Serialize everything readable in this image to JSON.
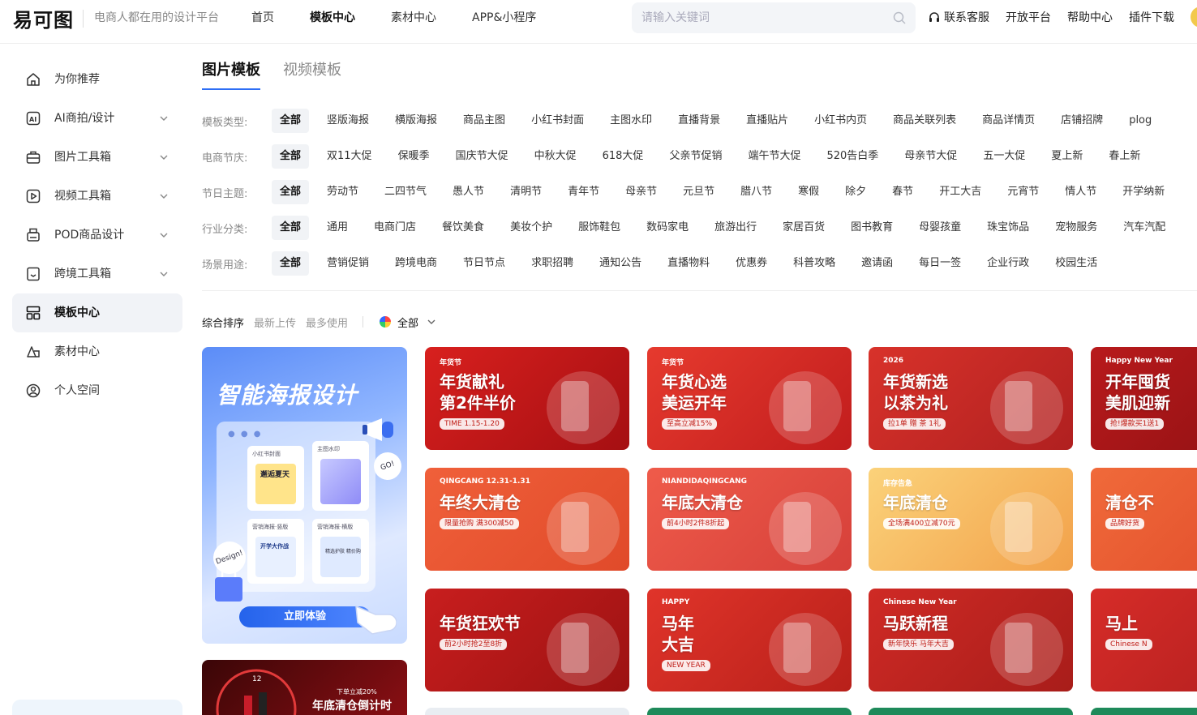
{
  "header": {
    "logo": "易可图",
    "slogan": "电商人都在用的设计平台",
    "nav": [
      "首页",
      "模板中心",
      "素材中心",
      "APP&小程序"
    ],
    "nav_active": 1,
    "search_placeholder": "请输入关键词",
    "links": [
      "联系客服",
      "开放平台",
      "帮助中心",
      "插件下载"
    ]
  },
  "sidebar": {
    "items": [
      {
        "label": "为你推荐",
        "icon": "home-icon",
        "expandable": false
      },
      {
        "label": "AI商拍/设计",
        "icon": "ai-icon",
        "expandable": true
      },
      {
        "label": "图片工具箱",
        "icon": "toolbox-icon",
        "expandable": true
      },
      {
        "label": "视频工具箱",
        "icon": "video-icon",
        "expandable": true
      },
      {
        "label": "POD商品设计",
        "icon": "print-icon",
        "expandable": true
      },
      {
        "label": "跨境工具箱",
        "icon": "bookmark-icon",
        "expandable": true
      },
      {
        "label": "模板中心",
        "icon": "grid-icon",
        "expandable": false
      },
      {
        "label": "素材中心",
        "icon": "shapes-icon",
        "expandable": false
      },
      {
        "label": "个人空间",
        "icon": "user-icon",
        "expandable": false
      }
    ],
    "active_index": 6
  },
  "tabs": [
    "图片模板",
    "视频模板"
  ],
  "filters": [
    {
      "label": "模板类型:",
      "options": [
        "全部",
        "竖版海报",
        "横版海报",
        "商品主图",
        "小红书封面",
        "主图水印",
        "直播背景",
        "直播贴片",
        "小红书内页",
        "商品关联列表",
        "商品详情页",
        "店铺招牌",
        "plog"
      ]
    },
    {
      "label": "电商节庆:",
      "options": [
        "全部",
        "双11大促",
        "保暖季",
        "国庆节大促",
        "中秋大促",
        "618大促",
        "父亲节促销",
        "端午节大促",
        "520告白季",
        "母亲节大促",
        "五一大促",
        "夏上新",
        "春上新"
      ]
    },
    {
      "label": "节日主题:",
      "options": [
        "全部",
        "劳动节",
        "二四节气",
        "愚人节",
        "清明节",
        "青年节",
        "母亲节",
        "元旦节",
        "腊八节",
        "寒假",
        "除夕",
        "春节",
        "开工大吉",
        "元宵节",
        "情人节",
        "开学纳新"
      ]
    },
    {
      "label": "行业分类:",
      "options": [
        "全部",
        "通用",
        "电商门店",
        "餐饮美食",
        "美妆个护",
        "服饰鞋包",
        "数码家电",
        "旅游出行",
        "家居百货",
        "图书教育",
        "母婴孩童",
        "珠宝饰品",
        "宠物服务",
        "汽车汽配"
      ]
    },
    {
      "label": "场景用途:",
      "options": [
        "全部",
        "营销促销",
        "跨境电商",
        "节日节点",
        "求职招聘",
        "通知公告",
        "直播物料",
        "优惠券",
        "科普攻略",
        "邀请函",
        "每日一签",
        "企业行政",
        "校园生活"
      ]
    }
  ],
  "sort": {
    "options": [
      "综合排序",
      "最新上传",
      "最多使用"
    ],
    "active": 0,
    "color_filter": "全部"
  },
  "poster": {
    "title": "智能海报设计",
    "card_labels": [
      "小红书封面",
      "主图水印",
      "营销海报·竖版",
      "营销海报·横版"
    ],
    "card_texts": [
      "邂逅夏天",
      "开学大作战",
      "精选护肤 精价购"
    ],
    "badges": [
      "GO!",
      "Design!"
    ],
    "cta": "立即体验"
  },
  "bottom_card": {
    "sub": "下单立减20%",
    "title": "年底清仓倒计时"
  },
  "cards": [
    {
      "tag": "年货节",
      "line1": "年货献礼",
      "line2": "第2件半价",
      "sub": "TIME 1.15-1.20",
      "bg": "#d8201e"
    },
    {
      "tag": "年货节",
      "line1": "年货心选",
      "line2": "美运开年",
      "sub": "至高立减15%",
      "bg": "#e63a2e"
    },
    {
      "tag": "2026",
      "line1": "年货新选",
      "line2": "以茶为礼",
      "sub": "拉1单 赠 茶 1礼",
      "bg": "#d8322a"
    },
    {
      "tag": "Happy New Year",
      "line1": "开年囤货",
      "line2": "美肌迎新",
      "sub": "抢!爆款买1送1",
      "bg": "#b81a1c"
    },
    {
      "tag": "QINGCANG 12.31-1.31",
      "line1": "年终大清仓",
      "line2": "",
      "sub": "限量抢购 满300减50",
      "bg": "#f0603a"
    },
    {
      "tag": "NIANDIDAQINGCANG",
      "line1": "年底大清仓",
      "line2": "",
      "sub": "前4小时2件8折起",
      "bg": "#ef5b4a"
    },
    {
      "tag": "库存告急",
      "line1": "年底清仓",
      "line2": "",
      "sub": "全场满400立减70元",
      "bg": "#fbd27a"
    },
    {
      "tag": "",
      "line1": "清仓不",
      "line2": "",
      "sub": "品牌好货",
      "bg": "#f06a3a"
    },
    {
      "tag": "",
      "line1": "年货狂欢节",
      "line2": "",
      "sub": "前2小时抢2至8折",
      "bg": "#c81e1e"
    },
    {
      "tag": "HAPPY",
      "line1": "马年",
      "line2": "大吉",
      "sub": "NEW YEAR",
      "bg": "#e0342a"
    },
    {
      "tag": "Chinese New Year",
      "line1": "马跃新程",
      "line2": "",
      "sub": "新年快乐 马年大吉",
      "bg": "#cf2a25"
    },
    {
      "tag": "",
      "line1": "马上",
      "line2": "",
      "sub": "Chinese N",
      "bg": "#d62c28"
    }
  ],
  "colors": {
    "accent": "#2e6ef5",
    "active_bg": "#f1f3f7",
    "strip_colors": [
      "#e9edf2",
      "#ff3b5c",
      "#1e8a5a",
      "#1e8a5a",
      "#1e8a5a"
    ]
  }
}
